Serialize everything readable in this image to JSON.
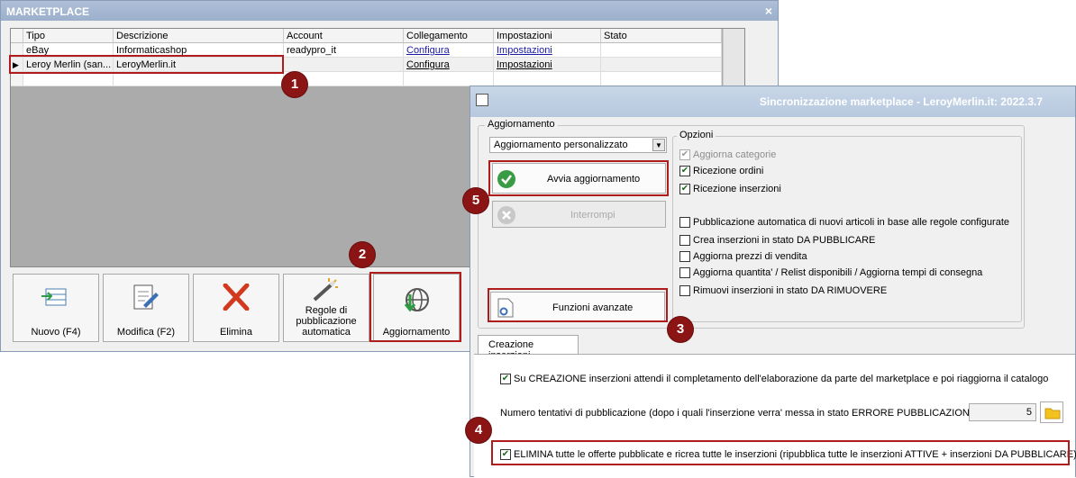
{
  "marketplace": {
    "title": "MARKETPLACE",
    "close_glyph": "×",
    "columns": [
      "Tipo",
      "Descrizione",
      "Account",
      "Collegamento",
      "Impostazioni",
      "Stato"
    ],
    "rows": [
      {
        "tipo": "eBay",
        "descrizione": "Informaticashop",
        "account": "readypro_it",
        "collegamento": "Configura",
        "impostazioni": "Impostazioni",
        "stato": ""
      },
      {
        "tipo": "Leroy Merlin (san...",
        "descrizione": "LeroyMerlin.it",
        "account": "",
        "collegamento": "Configura",
        "impostazioni": "Impostazioni",
        "stato": ""
      }
    ],
    "row_indicator": "▶",
    "toolbar": {
      "new": "Nuovo (F4)",
      "edit": "Modifica (F2)",
      "delete": "Elimina",
      "rules_line1": "Regole di",
      "rules_line2": "pubblicazione",
      "rules_line3": "automatica",
      "update": "Aggiornamento"
    }
  },
  "sync": {
    "title": "Sincronizzazione marketplace - LeroyMerlin.it: 2022.3.7",
    "update_group": "Aggiornamento",
    "mode_value": "Aggiornamento personalizzato",
    "start_button": "Avvia aggiornamento",
    "stop_button": "Interrompi",
    "advanced_button": "Funzioni avanzate",
    "options_group": "Opzioni",
    "options": [
      {
        "label": "Aggiorna categorie",
        "checked": true,
        "disabled": true
      },
      {
        "label": "Ricezione ordini",
        "checked": true,
        "disabled": false
      },
      {
        "label": "Ricezione inserzioni",
        "checked": true,
        "disabled": false
      },
      {
        "label": "Pubblicazione automatica di nuovi articoli in base alle regole configurate",
        "checked": false,
        "disabled": false
      },
      {
        "label": "Crea inserzioni in stato DA PUBBLICARE",
        "checked": false,
        "disabled": false
      },
      {
        "label": "Aggiorna prezzi di vendita",
        "checked": false,
        "disabled": false
      },
      {
        "label": "Aggiorna quantita' / Relist disponibili / Aggiorna tempi di consegna",
        "checked": false,
        "disabled": false
      },
      {
        "label": "Rimuovi inserzioni in stato DA RIMUOVERE",
        "checked": false,
        "disabled": false
      }
    ],
    "tab_label": "Creazione inserzioni",
    "wait_label": "Su CREAZIONE inserzioni attendi il completamento dell'elaborazione da parte del marketplace e poi riaggiorna il catalogo",
    "attempts_label": "Numero tentativi di pubblicazione (dopo i quali l'inserzione verra' messa in stato ERRORE PUBBLICAZIONE) :",
    "attempts_value": "5",
    "delete_label": "ELIMINA tutte le offerte pubblicate e ricrea tutte le inserzioni (ripubblica tutte le inserzioni ATTIVE + inserzioni DA PUBBLICARE)"
  },
  "badges": [
    "1",
    "2",
    "3",
    "4",
    "5"
  ],
  "colors": {
    "highlight": "#b01c1c",
    "badge": "#8b1414",
    "link": "#1a1aa6"
  }
}
